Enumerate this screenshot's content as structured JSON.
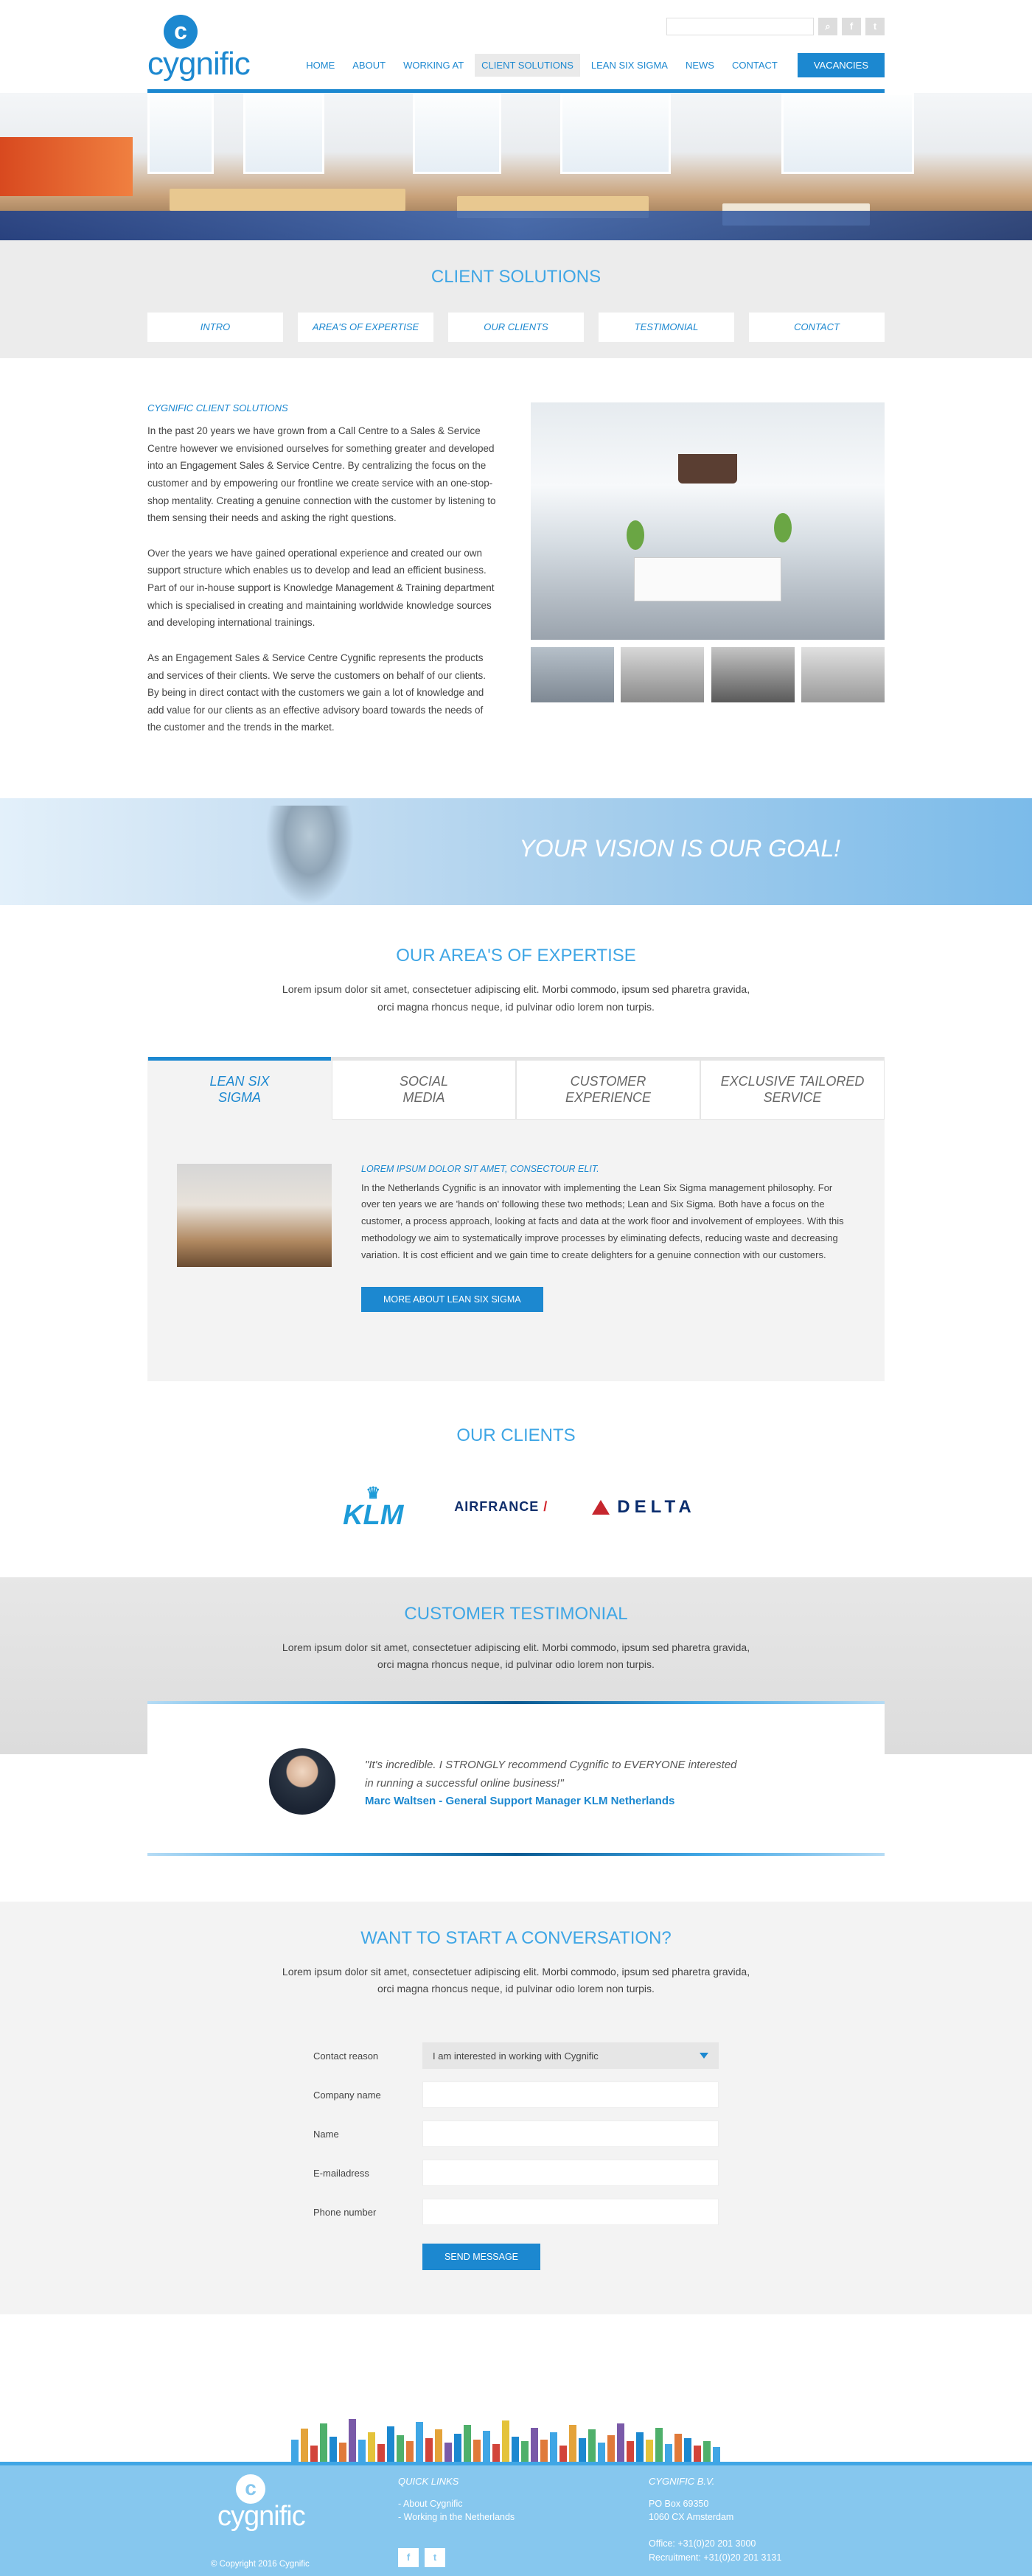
{
  "brand": {
    "name": "cygnific",
    "logo_letter": "c",
    "primary_color": "#1c88d0",
    "accent_color": "#3fa6e5"
  },
  "header": {
    "search_placeholder": "",
    "icons": [
      "search-icon",
      "facebook-icon",
      "twitter-icon"
    ],
    "nav": [
      {
        "label": "HOME",
        "active": false
      },
      {
        "label": "ABOUT",
        "active": false
      },
      {
        "label": "WORKING AT",
        "active": false
      },
      {
        "label": "CLIENT SOLUTIONS",
        "active": true
      },
      {
        "label": "LEAN SIX SIGMA",
        "active": false
      },
      {
        "label": "NEWS",
        "active": false
      },
      {
        "label": "CONTACT",
        "active": false
      }
    ],
    "cta": "VACANCIES"
  },
  "page": {
    "title": "CLIENT SOLUTIONS",
    "subnav": [
      "INTRO",
      "AREA'S OF EXPERTISE",
      "OUR CLIENTS",
      "TESTIMONIAL",
      "CONTACT"
    ]
  },
  "intro": {
    "heading": "CYGNIFIC CLIENT SOLUTIONS",
    "paragraphs": [
      "In the past 20 years we have grown from a Call Centre to a Sales & Service Centre however we envisioned ourselves for something greater and developed into an Engagement Sales & Service Centre. By centralizing the focus on the customer and by empowering our frontline we create service with an one-stop-shop mentality. Creating a genuine connection with the customer by listening to them sensing their needs and asking the right questions.",
      "Over the years we have gained operational experience and created our own support structure which enables us to develop and lead an efficient business. Part of our in-house support is Knowledge Management & Training department which is specialised in creating and maintaining worldwide knowledge sources and developing international trainings.",
      "As an Engagement Sales & Service Centre Cygnific represents the products and services of their clients. We serve the customers on behalf of our clients. By being in direct contact with the customers we gain a lot of knowledge and add value for our clients as an effective advisory board towards the needs of the customer and the trends in the market."
    ]
  },
  "vision": {
    "slogan": "YOUR VISION IS OUR GOAL!"
  },
  "expertise": {
    "title": "OUR AREA'S OF EXPERTISE",
    "intro_line1": "Lorem ipsum dolor sit amet, consectetuer adipiscing elit. Morbi commodo, ipsum sed pharetra gravida,",
    "intro_line2": "orci magna rhoncus neque, id pulvinar odio lorem non turpis.",
    "tabs": [
      {
        "line1": "LEAN SIX",
        "line2": "SIGMA",
        "active": true
      },
      {
        "line1": "SOCIAL",
        "line2": "MEDIA",
        "active": false
      },
      {
        "line1": "CUSTOMER",
        "line2": "EXPERIENCE",
        "active": false
      },
      {
        "line1": "EXCLUSIVE TAILORED",
        "line2": "SERVICE",
        "active": false
      }
    ],
    "panel_heading": "LOREM IPSUM DOLOR SIT AMET, CONSECTOUR ELIT.",
    "panel_text": "In the Netherlands Cygnific is an innovator with implementing the Lean Six Sigma management philosophy. For over ten years we are 'hands on' following these two methods; Lean and Six Sigma. Both have a focus on the customer, a process approach, looking at facts and data at the work floor and involvement of employees. With this methodology we aim to systematically improve processes by eliminating defects, reducing waste and decreasing variation. It is cost efficient and we gain time to create delighters for a genuine connection with our customers.",
    "panel_button": "MORE ABOUT LEAN SIX SIGMA"
  },
  "clients": {
    "title": "OUR CLIENTS",
    "logos": {
      "klm_crown": "♛",
      "klm": "KLM",
      "airfrance": "AIRFRANCE",
      "airfrance_mark": "/",
      "delta": "DELTA"
    }
  },
  "testimonial": {
    "title": "CUSTOMER TESTIMONIAL",
    "intro_line1": "Lorem ipsum dolor sit amet, consectetuer adipiscing elit. Morbi commodo, ipsum sed pharetra gravida,",
    "intro_line2": "orci magna rhoncus neque, id pulvinar odio lorem non turpis.",
    "quote": "\"It's incredible. I STRONGLY recommend Cygnific to EVERYONE interested in running a successful online business!\"",
    "author": "Marc Waltsen - General Support Manager KLM Netherlands"
  },
  "contact": {
    "title": "WANT TO START A CONVERSATION?",
    "intro_line1": "Lorem ipsum dolor sit amet, consectetuer adipiscing elit. Morbi commodo, ipsum sed pharetra gravida,",
    "intro_line2": "orci magna rhoncus neque, id pulvinar odio lorem non turpis.",
    "fields": {
      "reason_label": "Contact reason",
      "reason_value": "I am interested in working with Cygnific",
      "company_label": "Company name",
      "name_label": "Name",
      "email_label": "E-mailadress",
      "phone_label": "Phone number"
    },
    "submit": "SEND MESSAGE"
  },
  "footer": {
    "quick_links_title": "QUICK LINKS",
    "links": [
      "- About Cygnific",
      "- Working in the Netherlands"
    ],
    "company_title": "CYGNIFIC B.V.",
    "address_line1": "PO Box 69350",
    "address_line2": "1060 CX Amsterdam",
    "office": "Office: +31(0)20 201 3000",
    "recruitment": "Recruitment: +31(0)20 201 3131",
    "copyright": "© Copyright 2016 Cygnific",
    "social": {
      "facebook": "f",
      "twitter": "t"
    }
  }
}
